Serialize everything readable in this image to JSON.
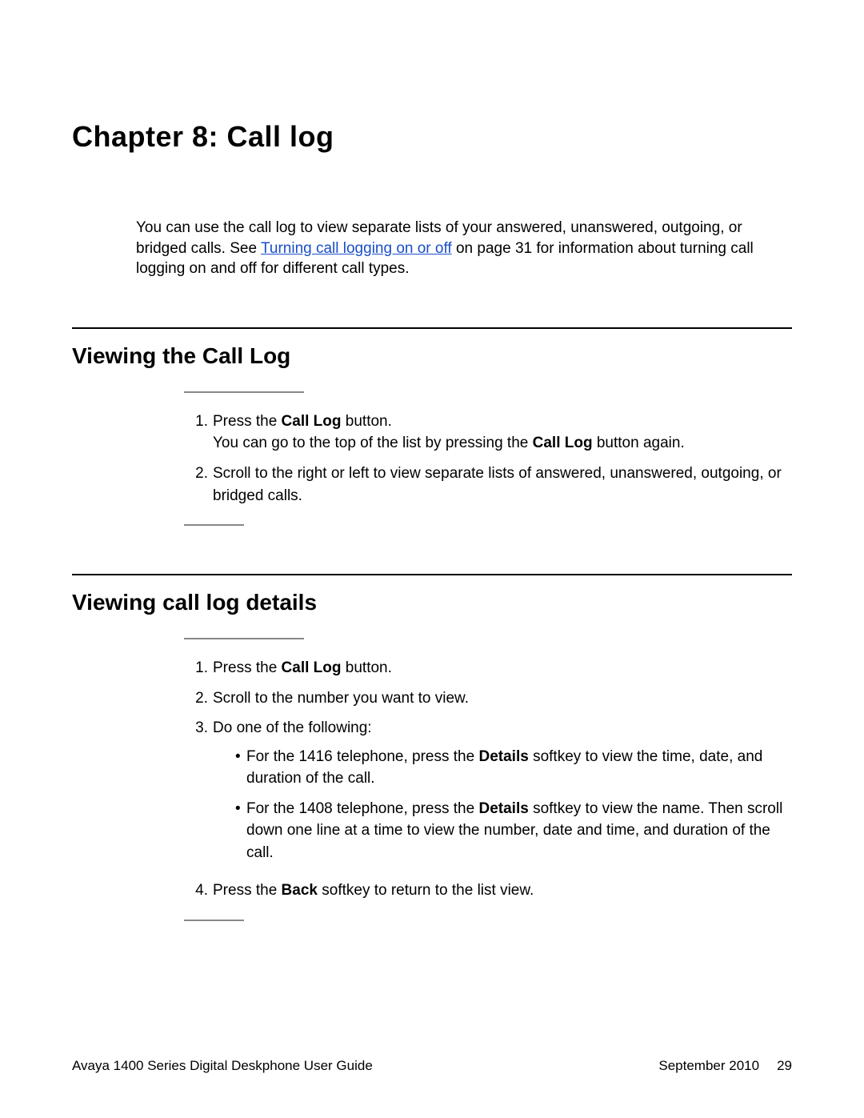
{
  "chapter": {
    "title": "Chapter 8:  Call log"
  },
  "intro": {
    "before": "You can use the call log to view separate lists of your answered, unanswered, outgoing, or bridged calls. See ",
    "link": "Turning call logging on or off",
    "after": " on page 31 for information about turning call logging on and off for different call types."
  },
  "section1": {
    "title": "Viewing the Call Log",
    "step1": {
      "num": "1.",
      "a": "Press the ",
      "b": "Call Log",
      "c": " button."
    },
    "step1_line2": {
      "a": "You can go to the top of the list by pressing the ",
      "b": "Call Log",
      "c": " button again."
    },
    "step2": {
      "num": "2.",
      "text": "Scroll to the right or left to view separate lists of answered, unanswered, outgoing, or bridged calls."
    }
  },
  "section2": {
    "title": "Viewing call log details",
    "step1": {
      "num": "1.",
      "a": "Press the ",
      "b": "Call Log",
      "c": " button."
    },
    "step2": {
      "num": "2.",
      "text": "Scroll to the number you want to view."
    },
    "step3": {
      "num": "3.",
      "text": "Do one of the following:"
    },
    "bullet1": {
      "a": "For the 1416 telephone, press the ",
      "b": "Details",
      "c": " softkey to view the time, date, and duration of the call."
    },
    "bullet2": {
      "a": "For the 1408 telephone, press the ",
      "b": "Details",
      "c": " softkey to view the name. Then scroll down one line at a time to view the number, date and time, and duration of the call."
    },
    "step4": {
      "num": "4.",
      "a": "Press the ",
      "b": "Back",
      "c": " softkey to return to the list view."
    }
  },
  "footer": {
    "left": "Avaya 1400 Series Digital Deskphone User Guide",
    "date": "September 2010",
    "page": "29"
  }
}
